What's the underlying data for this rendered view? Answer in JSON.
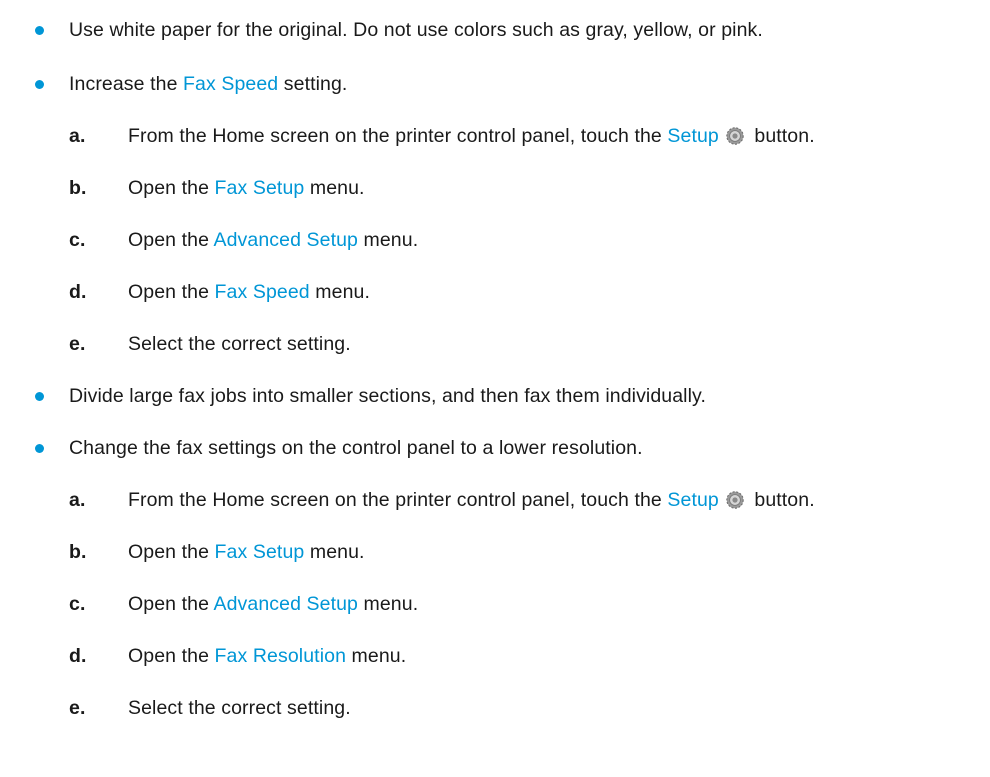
{
  "colors": {
    "accent": "#0096d6",
    "text": "#1a1a1a"
  },
  "items": [
    {
      "type": "bullet",
      "text": "Use white paper for the original. Do not use colors such as gray, yellow, or pink."
    },
    {
      "type": "bullet",
      "pre": "Increase the ",
      "link": "Fax Speed",
      "post": " setting."
    },
    {
      "type": "step",
      "marker": "a.",
      "pre": "From the Home screen on the printer control panel, touch the ",
      "link": "Setup",
      "icon": "gear-icon",
      "post": " button."
    },
    {
      "type": "step",
      "marker": "b.",
      "pre": "Open the ",
      "link": "Fax Setup",
      "post": " menu."
    },
    {
      "type": "step",
      "marker": "c.",
      "pre": "Open the ",
      "link": "Advanced Setup",
      "post": " menu."
    },
    {
      "type": "step",
      "marker": "d.",
      "pre": "Open the ",
      "link": "Fax Speed",
      "post": " menu."
    },
    {
      "type": "step",
      "marker": "e.",
      "text": "Select the correct setting."
    },
    {
      "type": "bullet",
      "text": "Divide large fax jobs into smaller sections, and then fax them individually."
    },
    {
      "type": "bullet",
      "text": "Change the fax settings on the control panel to a lower resolution."
    },
    {
      "type": "step",
      "marker": "a.",
      "pre": "From the Home screen on the printer control panel, touch the ",
      "link": "Setup",
      "icon": "gear-icon",
      "post": " button."
    },
    {
      "type": "step",
      "marker": "b.",
      "pre": "Open the ",
      "link": "Fax Setup",
      "post": " menu."
    },
    {
      "type": "step",
      "marker": "c.",
      "pre": "Open the ",
      "link": "Advanced Setup",
      "post": " menu."
    },
    {
      "type": "step",
      "marker": "d.",
      "pre": "Open the ",
      "link": "Fax Resolution",
      "post": " menu."
    },
    {
      "type": "step",
      "marker": "e.",
      "text": "Select the correct setting."
    }
  ]
}
